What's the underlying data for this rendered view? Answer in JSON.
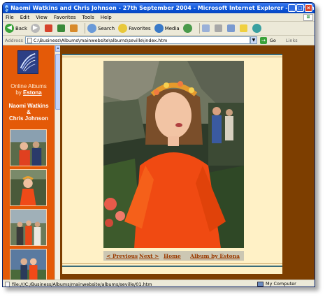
{
  "window": {
    "title": "Naomi Watkins and Chris Johnson - 27th September 2004 - Microsoft Internet Explorer - [Working Offline]"
  },
  "menu": [
    "File",
    "Edit",
    "View",
    "Favorites",
    "Tools",
    "Help"
  ],
  "toolbar": {
    "back": "Back",
    "search": "Search",
    "favorites": "Favorites",
    "media": "Media"
  },
  "address": {
    "label": "Address",
    "value": "C:\\Business\\Albums\\mainwebsite\\albums\\seville\\index.htm",
    "go": "Go",
    "links": "Links"
  },
  "sidebar": {
    "online_albums": "Online Albums",
    "by": "by",
    "by_link": "Estona",
    "name_1": "Naomi Watkins",
    "amp": "&",
    "name_2": "Chris Johnson"
  },
  "nav": {
    "previous": "< Previous",
    "next": "Next >",
    "home": "Home",
    "album_by": "Album by Estona"
  },
  "status": {
    "url": "file:///C:/Business/Albums/mainwebsite/albums/seville/01.htm",
    "zone": "My Computer"
  },
  "colors": {
    "sidebar": "#e45a08",
    "page_bg": "#7d3e00",
    "panel": "#fff1c6",
    "link": "#9a3a00"
  }
}
